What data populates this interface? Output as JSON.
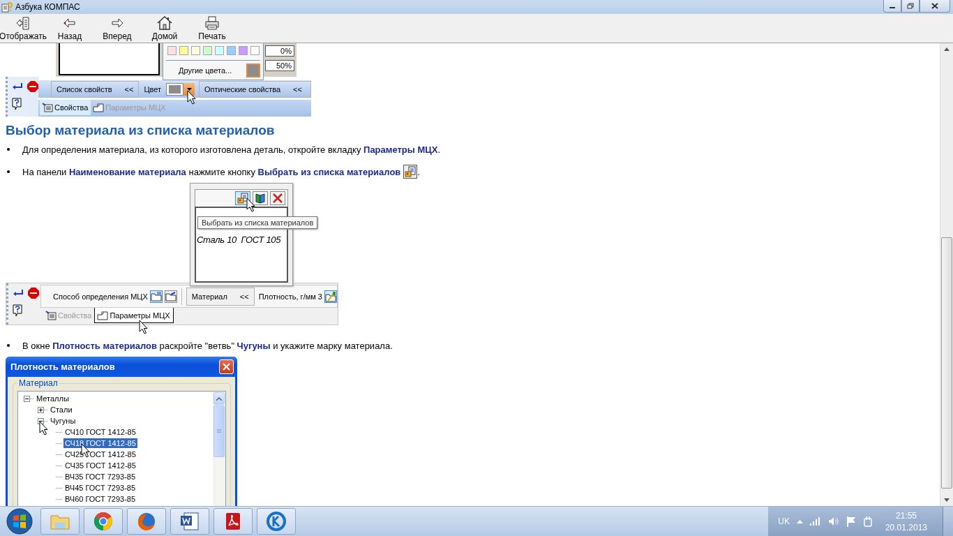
{
  "window": {
    "title": "Азбука КОМПАС"
  },
  "toolbar": [
    {
      "kind": "show",
      "label": "Отображать"
    },
    {
      "kind": "back",
      "label": "Назад"
    },
    {
      "kind": "forward",
      "label": "Вперед"
    },
    {
      "kind": "home",
      "label": "Домой"
    },
    {
      "kind": "print",
      "label": "Печать"
    }
  ],
  "figure_color": {
    "swatches": [
      {
        "color": "#fde0e0"
      },
      {
        "color": "#ffff99"
      },
      {
        "color": "#ffffe0"
      },
      {
        "color": "#ccffcc"
      },
      {
        "color": "#ccffff"
      },
      {
        "color": "#99ccff"
      },
      {
        "color": "#cc99ff"
      },
      {
        "color": "#ffffff"
      }
    ],
    "more_colors": "Другие цвета...",
    "field_1": "0%",
    "field_2": "50%",
    "property_list": {
      "label": "Список свойств",
      "chevron": "<<"
    },
    "color_label": "Цвет",
    "optical": {
      "label": "Оптические свойства",
      "chevron": "<<"
    },
    "tabs": [
      {
        "label": "Свойства",
        "selected": true,
        "disabled": false
      },
      {
        "label": "Параметры МЦХ",
        "selected": false,
        "disabled": true
      }
    ]
  },
  "heading": "Выбор материала из списка материалов",
  "bullets": [
    {
      "kind": "text",
      "text": "Для определения материала, из которого изготовлена деталь, откройте вкладку **Параметры МЦХ**."
    },
    {
      "kind": "button-icon",
      "text": "На панели **Наименование материала** нажмите кнопку **Выбрать из списка материалов**",
      "suffix": "."
    }
  ],
  "figure_material": {
    "tooltip": "Выбрать из списка материалов",
    "material_text": "Сталь 10  ГОСТ 105",
    "method_label": "Способ определения МЦХ",
    "material_button": {
      "label": "Материал",
      "chevron": "<<"
    },
    "density_label": "Плотность, г/мм 3",
    "tabs": [
      {
        "label": "Свойства",
        "selected": false,
        "disabled": true
      },
      {
        "label": "Параметры МЦХ",
        "selected": true,
        "disabled": false
      }
    ]
  },
  "bullets_2": [
    {
      "kind": "text",
      "text": "В окне **Плотность материалов** раскройте \"ветвь\" **Чугуны** и укажите марку материала."
    }
  ],
  "dialog": {
    "title": "Плотность материалов",
    "group": "Материал",
    "tree": [
      {
        "label": "Металлы",
        "expanded": true,
        "selected": false,
        "children": [
          {
            "label": "Стали",
            "expanded": false,
            "selected": false
          },
          {
            "label": "Чугуны",
            "expanded": true,
            "selected": false,
            "children": [
              {
                "label": "СЧ10  ГОСТ 1412-85",
                "selected": false
              },
              {
                "label": "СЧ18  ГОСТ 1412-85",
                "selected": true
              },
              {
                "label": "СЧ25  ГОСТ 1412-85",
                "selected": false
              },
              {
                "label": "СЧ35  ГОСТ 1412-85",
                "selected": false
              },
              {
                "label": "ВЧ35  ГОСТ 7293-85",
                "selected": false
              },
              {
                "label": "ВЧ45  ГОСТ 7293-85",
                "selected": false
              },
              {
                "label": "ВЧ60  ГОСТ 7293-85",
                "selected": false
              }
            ]
          }
        ]
      }
    ]
  },
  "taskbar": {
    "language": "UK",
    "time": "21:55",
    "date": "20.01.2013"
  }
}
